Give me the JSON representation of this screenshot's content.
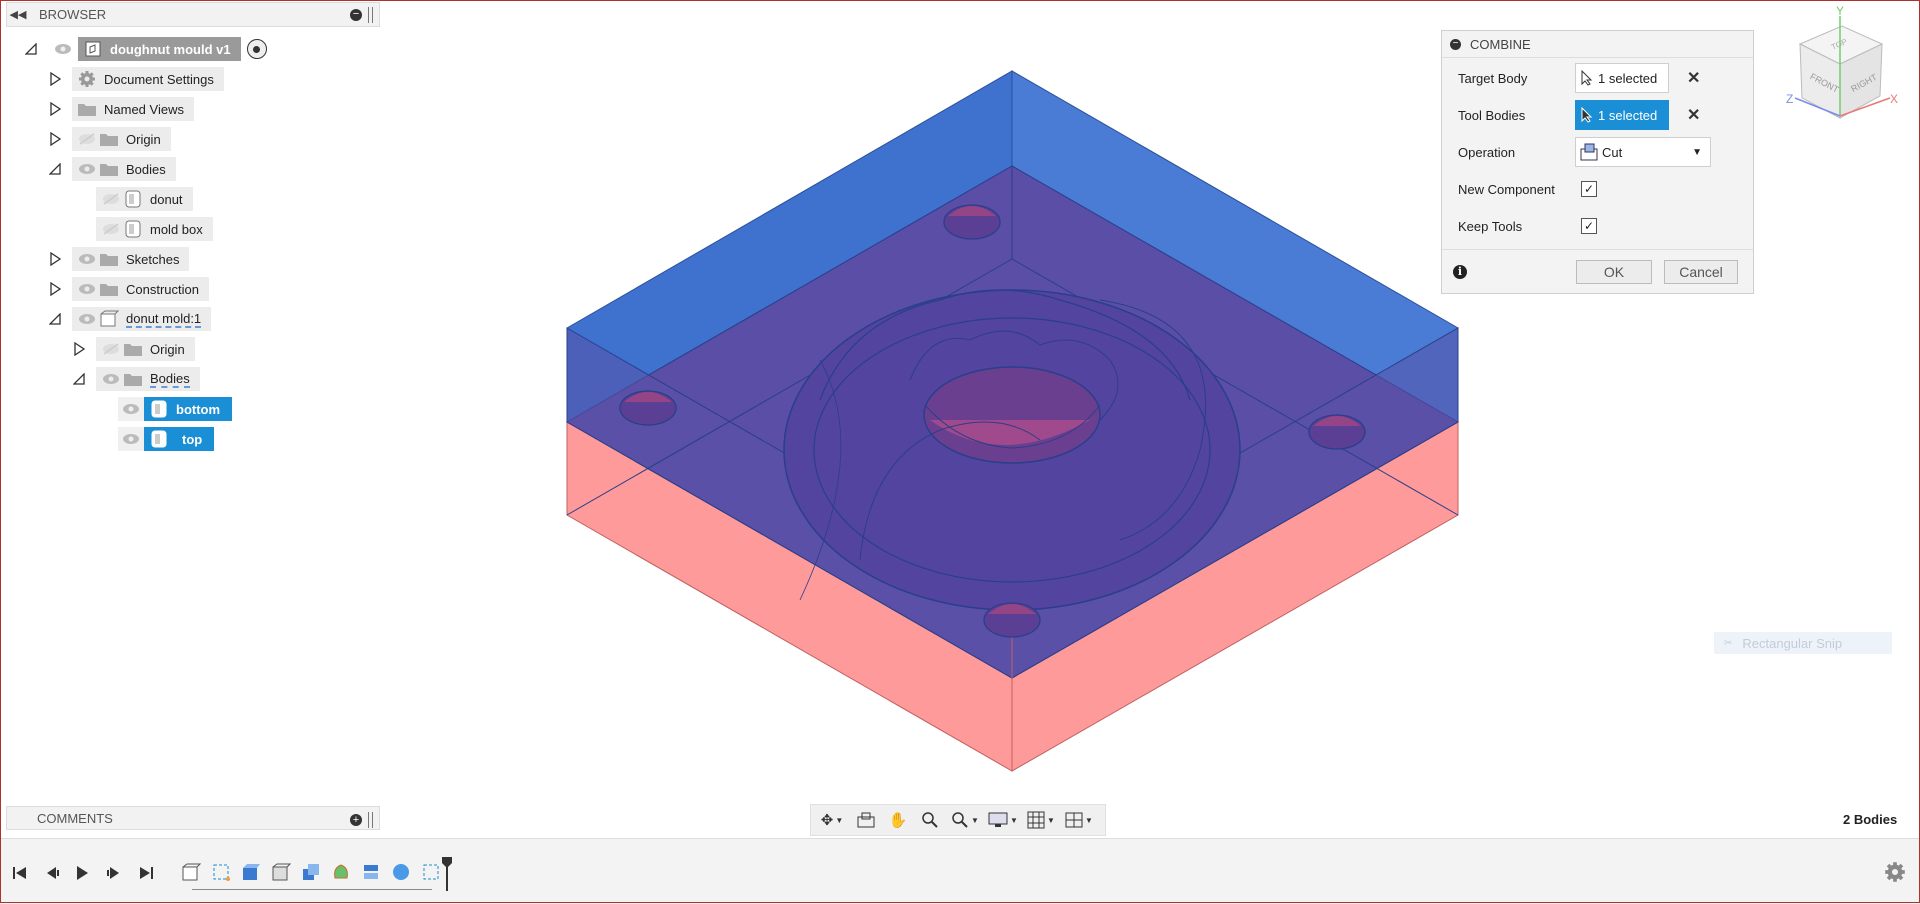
{
  "browser": {
    "title": "BROWSER",
    "root_label": "doughnut mould v1",
    "items": [
      {
        "label": "Document Settings",
        "icon": "gear-icon"
      },
      {
        "label": "Named Views",
        "icon": "folder-icon"
      },
      {
        "label": "Origin",
        "icon": "folder-icon"
      },
      {
        "label": "Bodies",
        "icon": "folder-icon"
      },
      {
        "label": "donut",
        "icon": "body-icon"
      },
      {
        "label": "mold box",
        "icon": "body-icon"
      },
      {
        "label": "Sketches",
        "icon": "folder-icon"
      },
      {
        "label": "Construction",
        "icon": "folder-icon"
      },
      {
        "label": "donut mold:1",
        "icon": "component-icon"
      },
      {
        "label": "Origin",
        "icon": "folder-icon"
      },
      {
        "label": "Bodies",
        "icon": "folder-icon"
      },
      {
        "label": "bottom",
        "icon": "body-icon"
      },
      {
        "label": "top",
        "icon": "body-icon"
      }
    ]
  },
  "comments": {
    "title": "COMMENTS"
  },
  "combine": {
    "title": "COMBINE",
    "target_body_label": "Target Body",
    "target_body_value": "1 selected",
    "tool_bodies_label": "Tool Bodies",
    "tool_bodies_value": "1 selected",
    "operation_label": "Operation",
    "operation_value": "Cut",
    "new_component_label": "New Component",
    "new_component_checked": true,
    "keep_tools_label": "Keep Tools",
    "keep_tools_checked": true,
    "ok_label": "OK",
    "cancel_label": "Cancel"
  },
  "viewcube": {
    "top": "TOP",
    "front": "FRONT",
    "right": "RIGHT",
    "axis_x": "X",
    "axis_y": "Y",
    "axis_z": "Z"
  },
  "overlay": {
    "snip_label": "Rectangular Snip"
  },
  "status": {
    "bodies_count": "2 Bodies"
  },
  "colors": {
    "selected": "#1a8fd6",
    "top_body": "#3b6fd1",
    "bottom_body": "#ff8a8a"
  }
}
